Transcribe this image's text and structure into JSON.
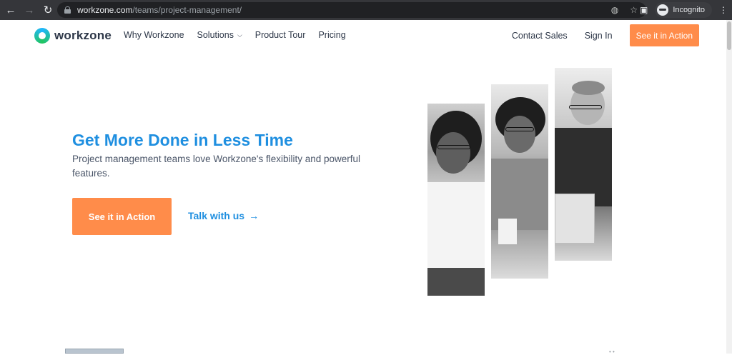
{
  "browser": {
    "url_host": "workzone.com",
    "url_path": "/teams/project-management/",
    "profile_label": "Incognito"
  },
  "site": {
    "logo_text": "workzone",
    "nav": [
      {
        "label": "Why Workzone"
      },
      {
        "label": "Solutions"
      },
      {
        "label": "Product Tour"
      },
      {
        "label": "Pricing"
      }
    ],
    "contact_label": "Contact Sales",
    "signin_label": "Sign In",
    "cta_label": "See it in Action"
  },
  "hero": {
    "title": "Get More Done in Less Time",
    "subtitle": "Project management teams love Workzone's flexibility and powerful features.",
    "cta_label": "See it in Action",
    "talk_label": "Talk with us"
  },
  "colors": {
    "accent_blue": "#1f8fe0",
    "cta_orange": "#ff8c4a"
  }
}
